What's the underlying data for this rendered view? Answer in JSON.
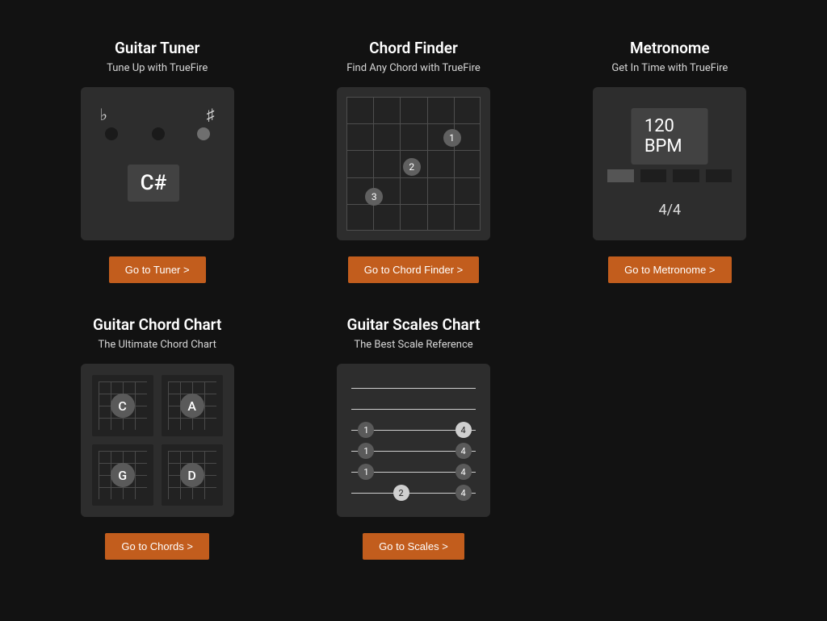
{
  "tools": [
    {
      "id": "tuner",
      "title": "Guitar Tuner",
      "subtitle": "Tune Up with TrueFire",
      "button": "Go to Tuner >",
      "preview": {
        "flat": "♭",
        "sharp": "♯",
        "note": "C#"
      }
    },
    {
      "id": "chord-finder",
      "title": "Chord Finder",
      "subtitle": "Find Any Chord with TrueFire",
      "button": "Go to Chord Finder >",
      "preview": {
        "dots": [
          "1",
          "2",
          "3"
        ]
      }
    },
    {
      "id": "metronome",
      "title": "Metronome",
      "subtitle": "Get In Time with TrueFire",
      "button": "Go to Metronome >",
      "preview": {
        "bpm": "120 BPM",
        "signature": "4/4",
        "beats": 4,
        "active": 1
      }
    },
    {
      "id": "chord-chart",
      "title": "Guitar Chord Chart",
      "subtitle": "The Ultimate Chord Chart",
      "button": "Go to Chords >",
      "preview": {
        "chords": [
          "C",
          "A",
          "G",
          "D"
        ]
      }
    },
    {
      "id": "scales-chart",
      "title": "Guitar Scales Chart",
      "subtitle": "The Best Scale Reference",
      "button": "Go to Scales >",
      "preview": {
        "strings": 6,
        "markers": [
          {
            "string": 2,
            "x": 0.12,
            "n": "1"
          },
          {
            "string": 3,
            "x": 0.12,
            "n": "1"
          },
          {
            "string": 4,
            "x": 0.12,
            "n": "1"
          },
          {
            "string": 5,
            "x": 0.4,
            "n": "2",
            "light": true
          },
          {
            "string": 2,
            "x": 0.9,
            "n": "4",
            "light": true
          },
          {
            "string": 3,
            "x": 0.9,
            "n": "4"
          },
          {
            "string": 4,
            "x": 0.9,
            "n": "4"
          },
          {
            "string": 5,
            "x": 0.9,
            "n": "4"
          }
        ]
      }
    }
  ],
  "colors": {
    "accent": "#c25d1d"
  }
}
